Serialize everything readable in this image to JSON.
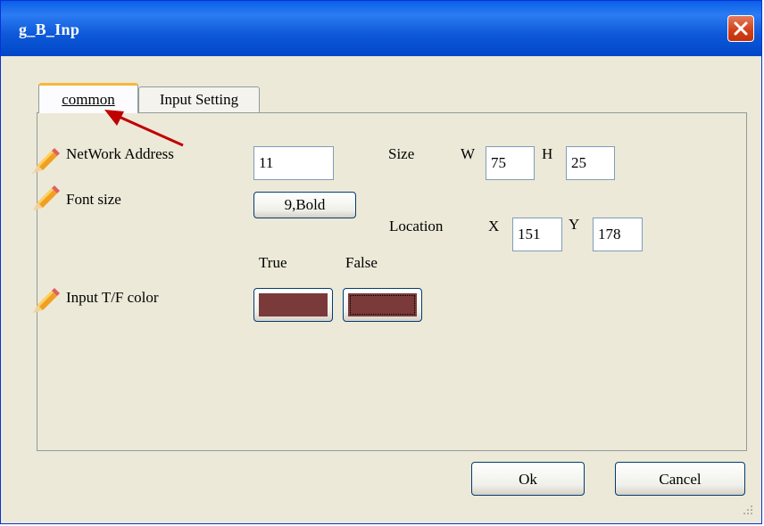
{
  "window": {
    "title": "g_B_Inp"
  },
  "tabs": [
    {
      "label": "common",
      "active": true
    },
    {
      "label": "Input Setting",
      "active": false
    }
  ],
  "form": {
    "network_address_label": "NetWork Address",
    "network_address_value": "11",
    "font_size_label": "Font size",
    "font_size_button": "9,Bold",
    "size_label": "Size",
    "w_label": "W",
    "w_value": "75",
    "h_label": "H",
    "h_value": "25",
    "location_label": "Location",
    "x_label": "X",
    "x_value": "151",
    "y_label": "Y",
    "y_value": "178",
    "true_label": "True",
    "false_label": "False",
    "input_tf_color_label": "Input T/F color",
    "true_color": "#7a3a3a",
    "false_color": "#7a3a3a"
  },
  "buttons": {
    "ok": "Ok",
    "cancel": "Cancel"
  },
  "colors": {
    "annotation_arrow": "#c00000",
    "title_bar": "#0a5fe6"
  }
}
